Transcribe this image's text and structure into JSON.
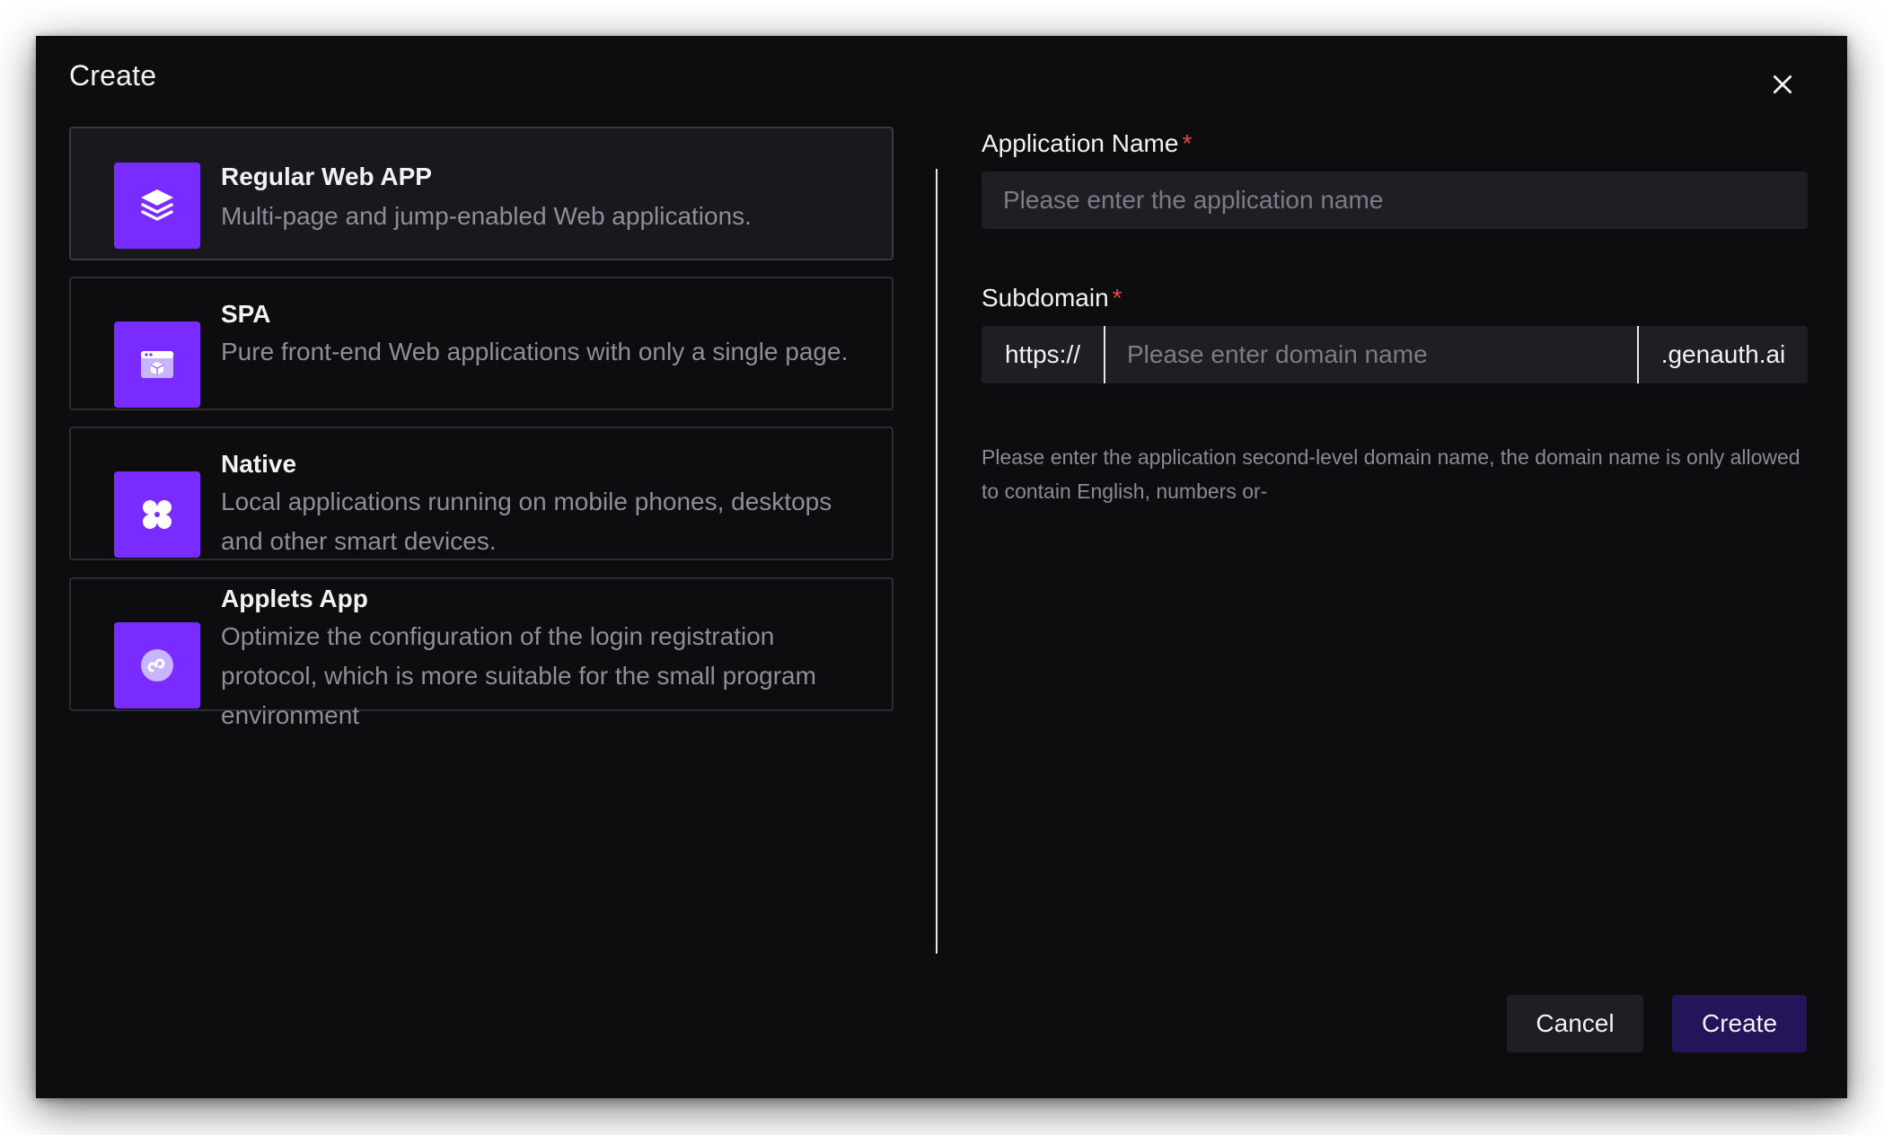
{
  "dialog": {
    "title": "Create"
  },
  "app_types": [
    {
      "title": "Regular Web APP",
      "description": "Multi-page and jump-enabled Web applications.",
      "icon": "layers-icon",
      "selected": true
    },
    {
      "title": "SPA",
      "description": "Pure front-end Web applications with only a single page.",
      "icon": "browser-window-icon",
      "selected": false
    },
    {
      "title": "Native",
      "description": "Local applications running on mobile phones, desktops and other smart devices.",
      "icon": "apps-grid-icon",
      "selected": false
    },
    {
      "title": "Applets App",
      "description": "Optimize the configuration of the login registration protocol, which is more suitable for the small program environment",
      "icon": "mini-program-icon",
      "selected": false
    }
  ],
  "form": {
    "app_name": {
      "label": "Application Name",
      "required_mark": "*",
      "placeholder": "Please enter the application name",
      "value": ""
    },
    "subdomain": {
      "label": "Subdomain",
      "required_mark": "*",
      "prefix": "https://",
      "placeholder": "Please enter domain name",
      "value": "",
      "suffix": ".genauth.ai",
      "hint": "Please enter the application second-level domain name, the domain name is only allowed to contain English, numbers or-"
    }
  },
  "footer": {
    "cancel_label": "Cancel",
    "create_label": "Create"
  },
  "colors": {
    "background": "#0d0d10",
    "accent": "#7a2bff",
    "primary_button": "#24145a",
    "required": "#e5484d"
  }
}
